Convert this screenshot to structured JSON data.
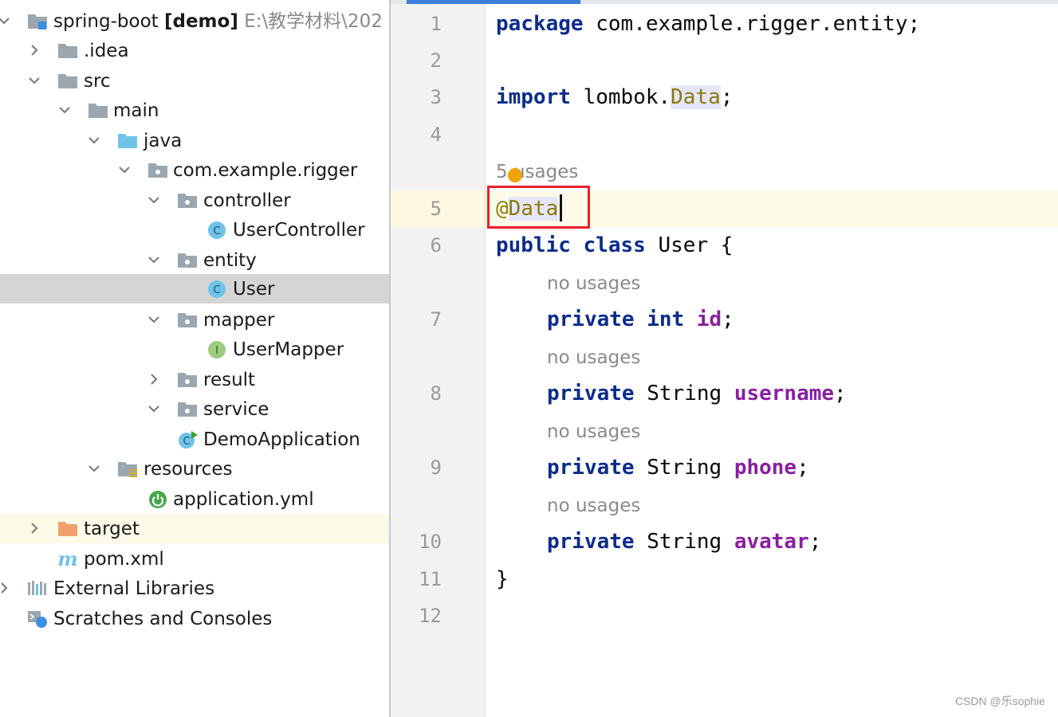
{
  "project_tree": {
    "items": [
      {
        "label": "spring-boot",
        "bold": "[demo]",
        "path": "E:\\教学材料\\202",
        "icon": "module-folder-icon",
        "chevron": "down"
      },
      {
        "label": ".idea",
        "icon": "folder-icon",
        "chevron": "right"
      },
      {
        "label": "src",
        "icon": "folder-icon",
        "chevron": "down"
      },
      {
        "label": "main",
        "icon": "folder-icon",
        "chevron": "down"
      },
      {
        "label": "java",
        "icon": "source-folder-icon",
        "chevron": "down"
      },
      {
        "label": "com.example.rigger",
        "icon": "package-icon",
        "chevron": "down"
      },
      {
        "label": "controller",
        "icon": "package-icon",
        "chevron": "down"
      },
      {
        "label": "UserController",
        "icon": "class-icon",
        "chevron": "none"
      },
      {
        "label": "entity",
        "icon": "package-icon",
        "chevron": "down"
      },
      {
        "label": "User",
        "icon": "class-icon",
        "chevron": "none"
      },
      {
        "label": "mapper",
        "icon": "package-icon",
        "chevron": "down"
      },
      {
        "label": "UserMapper",
        "icon": "interface-icon",
        "chevron": "none"
      },
      {
        "label": "result",
        "icon": "package-icon",
        "chevron": "right"
      },
      {
        "label": "service",
        "icon": "package-icon",
        "chevron": "down"
      },
      {
        "label": "DemoApplication",
        "icon": "spring-boot-class-icon",
        "chevron": "none"
      },
      {
        "label": "resources",
        "icon": "resources-folder-icon",
        "chevron": "down"
      },
      {
        "label": "application.yml",
        "icon": "spring-config-icon",
        "chevron": "none"
      },
      {
        "label": "target",
        "icon": "excluded-folder-icon",
        "chevron": "right"
      },
      {
        "label": "pom.xml",
        "icon": "maven-icon",
        "chevron": "none"
      },
      {
        "label": "External Libraries",
        "icon": "libraries-icon",
        "chevron": "right"
      },
      {
        "label": "Scratches and Consoles",
        "icon": "scratches-icon",
        "chevron": "none"
      }
    ]
  },
  "editor": {
    "line_numbers": [
      "1",
      "2",
      "3",
      "4",
      "5",
      "6",
      "7",
      "8",
      "9",
      "10",
      "11",
      "12"
    ],
    "usage_hints": {
      "class_usages": "5 usages",
      "no_usages": "no usages"
    },
    "code": {
      "l1_kw": "package",
      "l1_rest": " com.example.rigger.entity;",
      "l3_kw": "import",
      "l3_pre": " lombok.",
      "l3_hl": "Data",
      "l3_post": ";",
      "l5_at": "@",
      "l5_ann": "Data",
      "l6_kw": "public class",
      "l6_rest": " User {",
      "l7_kw": "private int",
      "l7_field": "id",
      "l8_kw": "private",
      "l8_type": " String ",
      "l8_field": "username",
      "l9_kw": "private",
      "l9_type": " String ",
      "l9_field": "phone",
      "l10_kw": "private",
      "l10_type": " String ",
      "l10_field": "avatar",
      "semicolon": ";",
      "l11": "}"
    }
  },
  "watermark": "CSDN @乐sophie",
  "colors": {
    "keyword": "#0b2c8c",
    "annotation": "#8a7a0a",
    "field": "#8a1ea0",
    "selected_row": "#d5d5d5",
    "highlight_box": "#e8202a"
  }
}
